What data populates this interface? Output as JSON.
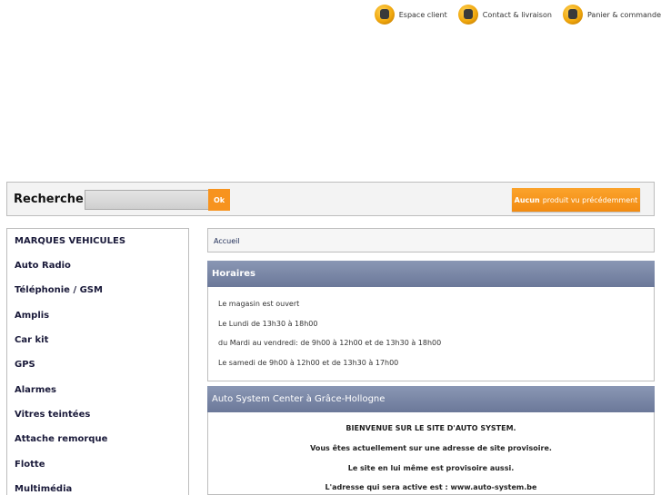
{
  "top_links": [
    {
      "label": "Espace client",
      "icon": "user-icon"
    },
    {
      "label": "Contact & livraison",
      "icon": "truck-icon"
    },
    {
      "label": "Panier & commande",
      "icon": "cart-icon"
    }
  ],
  "search": {
    "title": "Recherche",
    "value": "",
    "ok_label": "Ok"
  },
  "viewed": {
    "bold": "Aucun",
    "text": "produit vu précédemment"
  },
  "sidebar": {
    "items": [
      "MARQUES VEHICULES",
      "Auto Radio",
      "Téléphonie / GSM",
      "Amplis",
      "Car kit",
      "GPS",
      "Alarmes",
      "Vitres teintées",
      "Attache remorque",
      "Flotte",
      "Multimédia"
    ]
  },
  "breadcrumb": "Accueil",
  "hours": {
    "title": "Horaires",
    "lines": [
      "Le magasin est ouvert",
      "Le Lundi de 13h30 à 18h00",
      "du Mardi au vendredi: de 9h00 à 12h00 et de 13h30 à 18h00",
      "Le samedi de 9h00 à 12h00 et de 13h30 à 17h00"
    ]
  },
  "center": {
    "title": "Auto System Center à Grâce-Hollogne",
    "lines": [
      "BIENVENUE SUR LE SITE D'AUTO SYSTEM.",
      "Vous êtes actuellement sur une adresse de site provisoire.",
      "Le site en lui même est provisoire aussi.",
      "L'adresse qui sera active est : www.auto-system.be"
    ]
  },
  "colors": {
    "accent_orange": "#f7931e",
    "header_blue": "#7a87a8"
  }
}
